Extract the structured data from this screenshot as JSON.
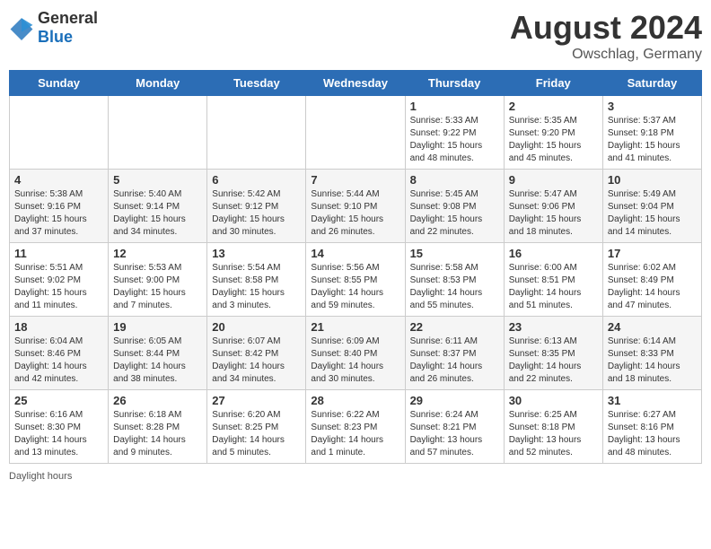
{
  "header": {
    "logo_general": "General",
    "logo_blue": "Blue",
    "month_year": "August 2024",
    "location": "Owschlag, Germany"
  },
  "footer": {
    "daylight_label": "Daylight hours"
  },
  "weekdays": [
    "Sunday",
    "Monday",
    "Tuesday",
    "Wednesday",
    "Thursday",
    "Friday",
    "Saturday"
  ],
  "weeks": [
    [
      {
        "day": "",
        "info": ""
      },
      {
        "day": "",
        "info": ""
      },
      {
        "day": "",
        "info": ""
      },
      {
        "day": "",
        "info": ""
      },
      {
        "day": "1",
        "info": "Sunrise: 5:33 AM\nSunset: 9:22 PM\nDaylight: 15 hours\nand 48 minutes."
      },
      {
        "day": "2",
        "info": "Sunrise: 5:35 AM\nSunset: 9:20 PM\nDaylight: 15 hours\nand 45 minutes."
      },
      {
        "day": "3",
        "info": "Sunrise: 5:37 AM\nSunset: 9:18 PM\nDaylight: 15 hours\nand 41 minutes."
      }
    ],
    [
      {
        "day": "4",
        "info": "Sunrise: 5:38 AM\nSunset: 9:16 PM\nDaylight: 15 hours\nand 37 minutes."
      },
      {
        "day": "5",
        "info": "Sunrise: 5:40 AM\nSunset: 9:14 PM\nDaylight: 15 hours\nand 34 minutes."
      },
      {
        "day": "6",
        "info": "Sunrise: 5:42 AM\nSunset: 9:12 PM\nDaylight: 15 hours\nand 30 minutes."
      },
      {
        "day": "7",
        "info": "Sunrise: 5:44 AM\nSunset: 9:10 PM\nDaylight: 15 hours\nand 26 minutes."
      },
      {
        "day": "8",
        "info": "Sunrise: 5:45 AM\nSunset: 9:08 PM\nDaylight: 15 hours\nand 22 minutes."
      },
      {
        "day": "9",
        "info": "Sunrise: 5:47 AM\nSunset: 9:06 PM\nDaylight: 15 hours\nand 18 minutes."
      },
      {
        "day": "10",
        "info": "Sunrise: 5:49 AM\nSunset: 9:04 PM\nDaylight: 15 hours\nand 14 minutes."
      }
    ],
    [
      {
        "day": "11",
        "info": "Sunrise: 5:51 AM\nSunset: 9:02 PM\nDaylight: 15 hours\nand 11 minutes."
      },
      {
        "day": "12",
        "info": "Sunrise: 5:53 AM\nSunset: 9:00 PM\nDaylight: 15 hours\nand 7 minutes."
      },
      {
        "day": "13",
        "info": "Sunrise: 5:54 AM\nSunset: 8:58 PM\nDaylight: 15 hours\nand 3 minutes."
      },
      {
        "day": "14",
        "info": "Sunrise: 5:56 AM\nSunset: 8:55 PM\nDaylight: 14 hours\nand 59 minutes."
      },
      {
        "day": "15",
        "info": "Sunrise: 5:58 AM\nSunset: 8:53 PM\nDaylight: 14 hours\nand 55 minutes."
      },
      {
        "day": "16",
        "info": "Sunrise: 6:00 AM\nSunset: 8:51 PM\nDaylight: 14 hours\nand 51 minutes."
      },
      {
        "day": "17",
        "info": "Sunrise: 6:02 AM\nSunset: 8:49 PM\nDaylight: 14 hours\nand 47 minutes."
      }
    ],
    [
      {
        "day": "18",
        "info": "Sunrise: 6:04 AM\nSunset: 8:46 PM\nDaylight: 14 hours\nand 42 minutes."
      },
      {
        "day": "19",
        "info": "Sunrise: 6:05 AM\nSunset: 8:44 PM\nDaylight: 14 hours\nand 38 minutes."
      },
      {
        "day": "20",
        "info": "Sunrise: 6:07 AM\nSunset: 8:42 PM\nDaylight: 14 hours\nand 34 minutes."
      },
      {
        "day": "21",
        "info": "Sunrise: 6:09 AM\nSunset: 8:40 PM\nDaylight: 14 hours\nand 30 minutes."
      },
      {
        "day": "22",
        "info": "Sunrise: 6:11 AM\nSunset: 8:37 PM\nDaylight: 14 hours\nand 26 minutes."
      },
      {
        "day": "23",
        "info": "Sunrise: 6:13 AM\nSunset: 8:35 PM\nDaylight: 14 hours\nand 22 minutes."
      },
      {
        "day": "24",
        "info": "Sunrise: 6:14 AM\nSunset: 8:33 PM\nDaylight: 14 hours\nand 18 minutes."
      }
    ],
    [
      {
        "day": "25",
        "info": "Sunrise: 6:16 AM\nSunset: 8:30 PM\nDaylight: 14 hours\nand 13 minutes."
      },
      {
        "day": "26",
        "info": "Sunrise: 6:18 AM\nSunset: 8:28 PM\nDaylight: 14 hours\nand 9 minutes."
      },
      {
        "day": "27",
        "info": "Sunrise: 6:20 AM\nSunset: 8:25 PM\nDaylight: 14 hours\nand 5 minutes."
      },
      {
        "day": "28",
        "info": "Sunrise: 6:22 AM\nSunset: 8:23 PM\nDaylight: 14 hours\nand 1 minute."
      },
      {
        "day": "29",
        "info": "Sunrise: 6:24 AM\nSunset: 8:21 PM\nDaylight: 13 hours\nand 57 minutes."
      },
      {
        "day": "30",
        "info": "Sunrise: 6:25 AM\nSunset: 8:18 PM\nDaylight: 13 hours\nand 52 minutes."
      },
      {
        "day": "31",
        "info": "Sunrise: 6:27 AM\nSunset: 8:16 PM\nDaylight: 13 hours\nand 48 minutes."
      }
    ]
  ]
}
